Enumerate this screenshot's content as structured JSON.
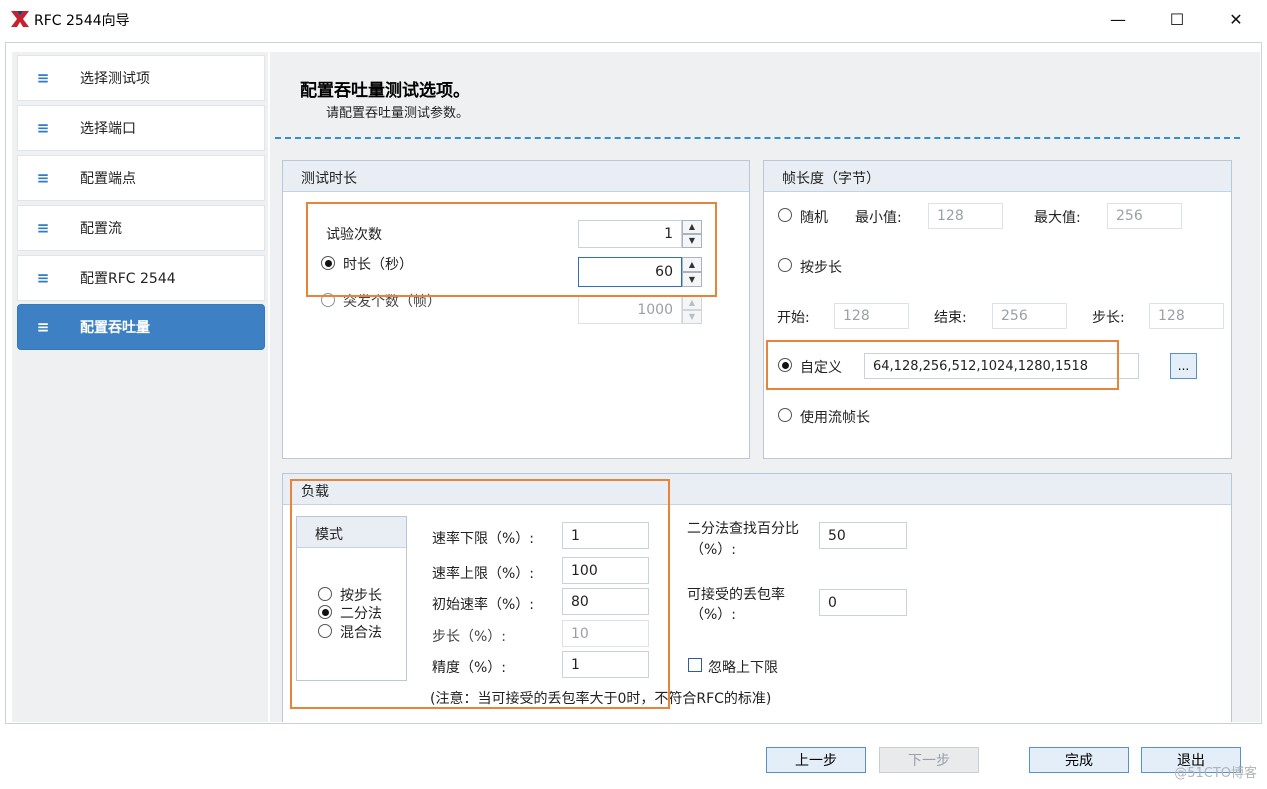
{
  "window": {
    "title": "RFC 2544向导",
    "controls": {
      "minimize": "—",
      "maximize": "☐",
      "close": "✕"
    }
  },
  "sidebar": {
    "items": [
      {
        "label": "选择测试项",
        "active": false
      },
      {
        "label": "选择端口",
        "active": false
      },
      {
        "label": "配置端点",
        "active": false
      },
      {
        "label": "配置流",
        "active": false
      },
      {
        "label": "配置RFC 2544",
        "active": false
      },
      {
        "label": "配置吞吐量",
        "active": true
      }
    ],
    "item_icon": "≡"
  },
  "page": {
    "title": "配置吞吐量测试选项。",
    "subtitle": "请配置吞吐量测试参数。"
  },
  "duration": {
    "title": "测试时长",
    "trials_label": "试验次数",
    "trials_value": "1",
    "time_label": "时长（秒）",
    "time_value": "60",
    "burst_label": "突发个数（帧）",
    "burst_value": "1000"
  },
  "frame_length": {
    "title": "帧长度（字节）",
    "random_label": "随机",
    "min_label": "最小值:",
    "min_value": "128",
    "max_label": "最大值:",
    "max_value": "256",
    "step_label": "按步长",
    "start_label": "开始:",
    "start_value": "128",
    "end_label": "结束:",
    "end_value": "256",
    "stepsize_label": "步长:",
    "stepsize_value": "128",
    "custom_label": "自定义",
    "custom_value": "64,128,256,512,1024,1280,1518",
    "browse_label": "...",
    "stream_label": "使用流帧长"
  },
  "load": {
    "title": "负载",
    "mode_title": "模式",
    "mode_step": "按步长",
    "mode_binary": "二分法",
    "mode_mixed": "混合法",
    "rate_low_label": "速率下限（%）:",
    "rate_low_value": "1",
    "rate_high_label": "速率上限（%）:",
    "rate_high_value": "100",
    "rate_init_label": "初始速率（%）:",
    "rate_init_value": "80",
    "step_label": "步长（%）:",
    "step_value": "10",
    "precision_label": "精度（%）:",
    "precision_value": "1",
    "binary_pct_label_1": "二分法查找百分比",
    "binary_pct_label_2": "（%）:",
    "binary_pct_value": "50",
    "loss_label_1": "可接受的丢包率",
    "loss_label_2": "（%）:",
    "loss_value": "0",
    "ignore_label": "忽略上下限",
    "note": "(注意：当可接受的丢包率大于0时，不符合RFC的标准)"
  },
  "footer": {
    "prev": "上一步",
    "next": "下一步",
    "finish": "完成",
    "exit": "退出"
  },
  "watermark": "@51CTO博客",
  "colors": {
    "accent": "#3d80c4",
    "highlight": "#e8843a",
    "dash": "#2f8fd0"
  }
}
